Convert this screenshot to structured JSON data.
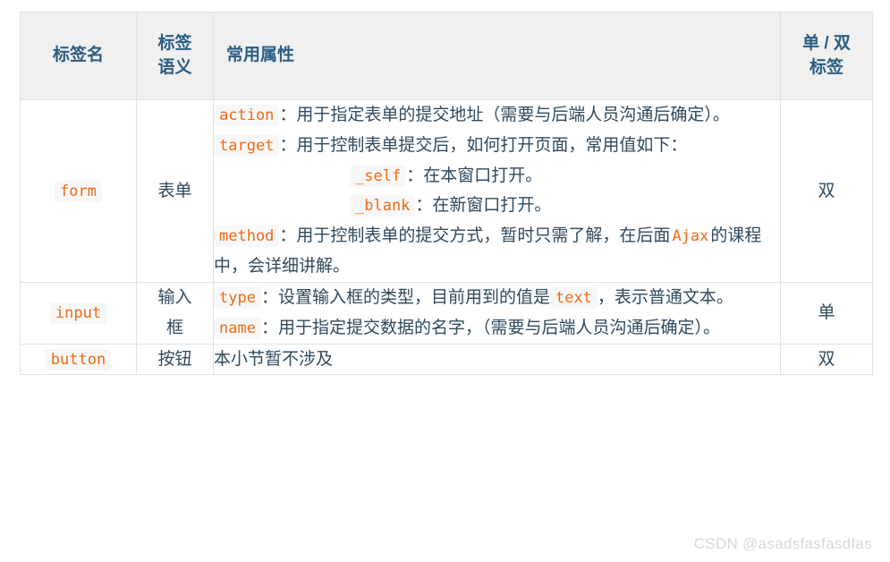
{
  "colors": {
    "code_text": "#f06a14",
    "code_bg": "#f7f7f7",
    "header_bg": "#f0f0f0",
    "header_text": "#2b5d82",
    "body_text": "#2f4a5e",
    "border": "#dfe2e5",
    "watermark": "#d8d8d8"
  },
  "table": {
    "headers": {
      "tag_name": "标签名",
      "tag_semantics": "标签\n语义",
      "tag_semantics_line1": "标签",
      "tag_semantics_line2": "语义",
      "common_attributes": "常用属性",
      "single_double": "单 / 双\n标签",
      "single_double_line1": "单 / 双",
      "single_double_line2": "标签"
    },
    "rows": [
      {
        "tag": "form",
        "semantics": "表单",
        "pair": "双",
        "attributes": [
          {
            "indent": 0,
            "code": "action",
            "text": "：用于指定表单的提交地址（需要与后端人员沟通后确定）。"
          },
          {
            "indent": 0,
            "code": "target",
            "text": "：用于控制表单提交后，如何打开页面，常用值如下："
          },
          {
            "indent": 1,
            "code": "_self",
            "text": "：在本窗口打开。"
          },
          {
            "indent": 1,
            "code": "_blank",
            "text": "：在新窗口打开。"
          },
          {
            "indent": 0,
            "code": "method",
            "text": "：用于控制表单的提交方式，暂时只需了解，在后面",
            "code2": "Ajax",
            "text2": "的课程中，会详细讲解。"
          }
        ]
      },
      {
        "tag": "input",
        "semantics": "输入\n框",
        "semantics_line1": "输入",
        "semantics_line2": "框",
        "pair": "单",
        "attributes": [
          {
            "indent": 0,
            "code": "type",
            "text": "：设置输入框的类型，目前用到的值是",
            "code2": "text",
            "text2": "，表示普通文本。"
          },
          {
            "indent": 0,
            "code": "name",
            "text": "：用于指定提交数据的名字，（需要与后端人员沟通后确定）。"
          }
        ]
      },
      {
        "tag": "button",
        "semantics": "按钮",
        "pair": "双",
        "plain_text": "本小节暂不涉及"
      }
    ]
  },
  "watermark": "CSDN @asadsfasfasdfas"
}
